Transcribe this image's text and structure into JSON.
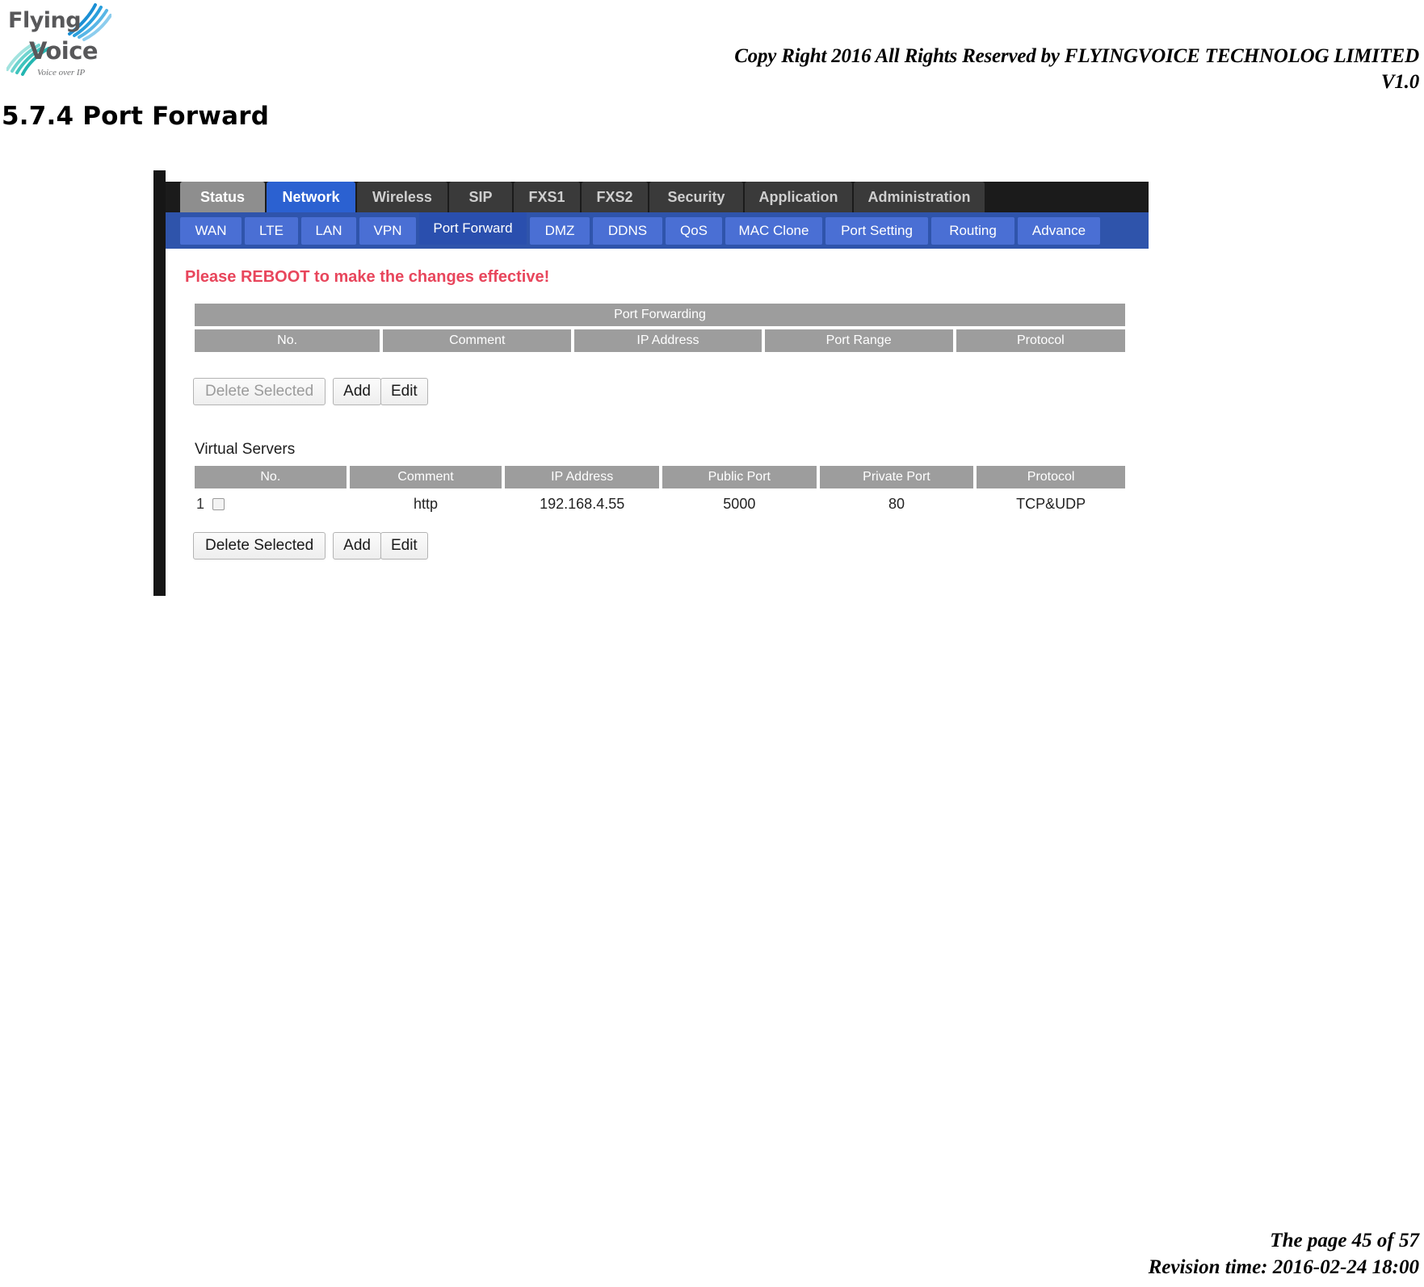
{
  "document": {
    "logo": {
      "line1": "Flying",
      "line2": "Voice",
      "tagline": "Voice over IP"
    },
    "copyright": "Copy Right 2016 All Rights Reserved by FLYINGVOICE TECHNOLOG LIMITED",
    "version": "V1.0",
    "heading": "5.7.4 Port Forward",
    "footer": {
      "page": "The page 45 of 57",
      "revision": "Revision time: 2016-02-24 18:00"
    }
  },
  "router_ui": {
    "main_tabs": [
      {
        "label": "Status",
        "state": "inactive-light"
      },
      {
        "label": "Network",
        "state": "active"
      },
      {
        "label": "Wireless",
        "state": "inactive"
      },
      {
        "label": "SIP",
        "state": "inactive"
      },
      {
        "label": "FXS1",
        "state": "inactive"
      },
      {
        "label": "FXS2",
        "state": "inactive"
      },
      {
        "label": "Security",
        "state": "inactive"
      },
      {
        "label": "Application",
        "state": "inactive"
      },
      {
        "label": "Administration",
        "state": "inactive"
      }
    ],
    "sub_tabs": [
      {
        "label": "WAN",
        "active": false
      },
      {
        "label": "LTE",
        "active": false
      },
      {
        "label": "LAN",
        "active": false
      },
      {
        "label": "VPN",
        "active": false
      },
      {
        "label": "Port Forward",
        "active": true
      },
      {
        "label": "DMZ",
        "active": false
      },
      {
        "label": "DDNS",
        "active": false
      },
      {
        "label": "QoS",
        "active": false
      },
      {
        "label": "MAC Clone",
        "active": false
      },
      {
        "label": "Port Setting",
        "active": false
      },
      {
        "label": "Routing",
        "active": false
      },
      {
        "label": "Advance",
        "active": false
      }
    ],
    "notice": "Please REBOOT to make the changes effective!",
    "port_forwarding": {
      "title": "Port Forwarding",
      "columns": [
        "No.",
        "Comment",
        "IP Address",
        "Port Range",
        "Protocol"
      ],
      "rows": [],
      "buttons": {
        "delete_selected": "Delete Selected",
        "add": "Add",
        "edit": "Edit",
        "delete_disabled": true
      }
    },
    "virtual_servers": {
      "title": "Virtual Servers",
      "columns": [
        "No.",
        "Comment",
        "IP Address",
        "Public Port",
        "Private Port",
        "Protocol"
      ],
      "rows": [
        {
          "no": "1",
          "checked": false,
          "comment": "http",
          "ip_address": "192.168.4.55",
          "public_port": "5000",
          "private_port": "80",
          "protocol": "TCP&UDP"
        }
      ],
      "buttons": {
        "delete_selected": "Delete Selected",
        "add": "Add",
        "edit": "Edit",
        "delete_disabled": false
      }
    },
    "colors": {
      "active_tab_blue": "#2b61d1",
      "subnav_blue": "#2f54ab",
      "table_header_gray": "#9d9d9d",
      "notice_red": "#e8465c"
    }
  }
}
